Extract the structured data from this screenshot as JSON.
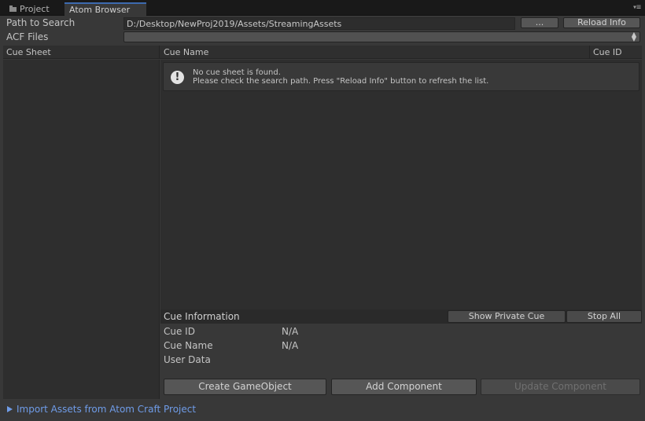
{
  "tabs": {
    "project_label": "Project",
    "atom_label": "Atom Browser",
    "menu_glyph": "▾≡"
  },
  "toolbar": {
    "path_label": "Path to Search",
    "path_value": "D:/Desktop/NewProj2019/Assets/StreamingAssets",
    "browse_label": "...",
    "reload_label": "Reload Info",
    "acf_label": "ACF Files",
    "acf_value": ""
  },
  "columns": {
    "cue_sheet": "Cue Sheet",
    "cue_name": "Cue Name",
    "cue_id": "Cue ID"
  },
  "message": {
    "icon": "info-icon",
    "line1": "No cue sheet is found.",
    "line2": "Please check the search path. Press \"Reload Info\" button to refresh the list."
  },
  "cue_info": {
    "title": "Cue Information",
    "show_private_label": "Show Private Cue",
    "stop_all_label": "Stop All",
    "id_label": "Cue ID",
    "id_value": "N/A",
    "name_label": "Cue Name",
    "name_value": "N/A",
    "user_data_label": "User Data",
    "user_data_value": ""
  },
  "actions": {
    "create_label": "Create GameObject",
    "add_label": "Add Component",
    "update_label": "Update Component"
  },
  "import": {
    "label": "Import Assets from Atom Craft Project"
  },
  "colors": {
    "accent": "#3d6ab0",
    "link": "#6f9ce8",
    "panel": "#383838"
  }
}
